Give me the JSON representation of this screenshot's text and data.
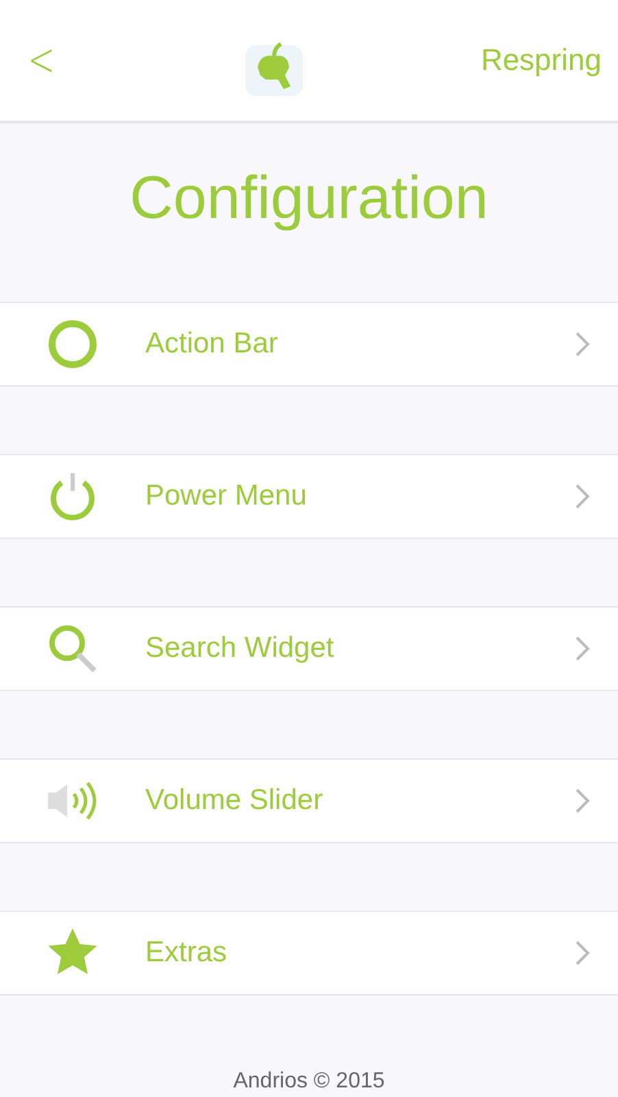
{
  "nav": {
    "back": "<",
    "action": "Respring"
  },
  "title": "Configuration",
  "items": [
    {
      "kind": "ring",
      "label": "Action Bar"
    },
    {
      "kind": "power",
      "label": "Power Menu"
    },
    {
      "kind": "search",
      "label": "Search Widget"
    },
    {
      "kind": "volume",
      "label": "Volume Slider"
    },
    {
      "kind": "star",
      "label": "Extras"
    }
  ],
  "footer": "Andrios © 2015"
}
